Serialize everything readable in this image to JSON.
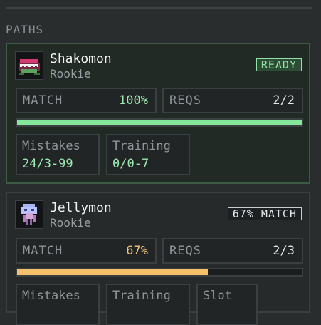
{
  "section_title": "PATHS",
  "colors": {
    "ready": "#93e3a6",
    "progress_green": "#84e79b",
    "progress_orange": "#f5c26b",
    "value_green": "#9be8b0",
    "value_orange": "#f3c27a"
  },
  "paths": [
    {
      "name": "Shakomon",
      "level": "Rookie",
      "avatar_icon": "shakomon-sprite-icon",
      "status": "READY",
      "match_label": "MATCH",
      "match_value": "100%",
      "match_fraction": 1.0,
      "reqs_label": "REQS",
      "reqs_value": "2/2",
      "mistakes_label": "Mistakes",
      "mistakes_value": "24/3-99",
      "training_label": "Training",
      "training_value": "0/0-7"
    },
    {
      "name": "Jellymon",
      "level": "Rookie",
      "avatar_icon": "jellymon-sprite-icon",
      "status": "67% MATCH",
      "match_label": "MATCH",
      "match_value": "67%",
      "match_fraction": 0.67,
      "reqs_label": "REQS",
      "reqs_value": "2/3",
      "mistakes_label": "Mistakes",
      "training_label": "Training",
      "slot_label": "Slot"
    }
  ]
}
